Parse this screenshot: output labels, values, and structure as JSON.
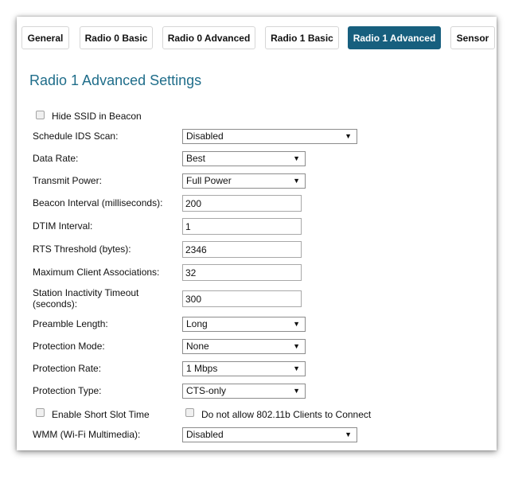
{
  "tabs": [
    {
      "label": "General"
    },
    {
      "label": "Radio 0 Basic"
    },
    {
      "label": "Radio 0 Advanced"
    },
    {
      "label": "Radio 1 Basic"
    },
    {
      "label": "Radio 1 Advanced"
    },
    {
      "label": "Sensor"
    }
  ],
  "title": "Radio 1 Advanced Settings",
  "hide_ssid": {
    "label": "Hide SSID in Beacon",
    "checked": false
  },
  "fields": {
    "schedule_ids": {
      "label": "Schedule IDS Scan:",
      "value": "Disabled"
    },
    "data_rate": {
      "label": "Data Rate:",
      "value": "Best"
    },
    "transmit_power": {
      "label": "Transmit Power:",
      "value": "Full Power"
    },
    "beacon_interval": {
      "label": "Beacon Interval (milliseconds):",
      "value": "200"
    },
    "dtim_interval": {
      "label": "DTIM Interval:",
      "value": "1"
    },
    "rts_threshold": {
      "label": "RTS Threshold (bytes):",
      "value": "2346"
    },
    "max_clients": {
      "label": "Maximum Client Associations:",
      "value": "32"
    },
    "inactivity_timeout": {
      "label_line1": "Station Inactivity Timeout",
      "label_line2": "(seconds):",
      "value": "300"
    },
    "preamble_length": {
      "label": "Preamble Length:",
      "value": "Long"
    },
    "protection_mode": {
      "label": "Protection Mode:",
      "value": "None"
    },
    "protection_rate": {
      "label": "Protection Rate:",
      "value": "1 Mbps"
    },
    "protection_type": {
      "label": "Protection Type:",
      "value": "CTS-only"
    },
    "wmm": {
      "label": "WMM (Wi-Fi Multimedia):",
      "value": "Disabled"
    }
  },
  "short_slot": {
    "label": "Enable Short Slot Time",
    "checked": false
  },
  "no_80211b": {
    "label": "Do not allow 802.11b Clients to Connect",
    "checked": false
  }
}
